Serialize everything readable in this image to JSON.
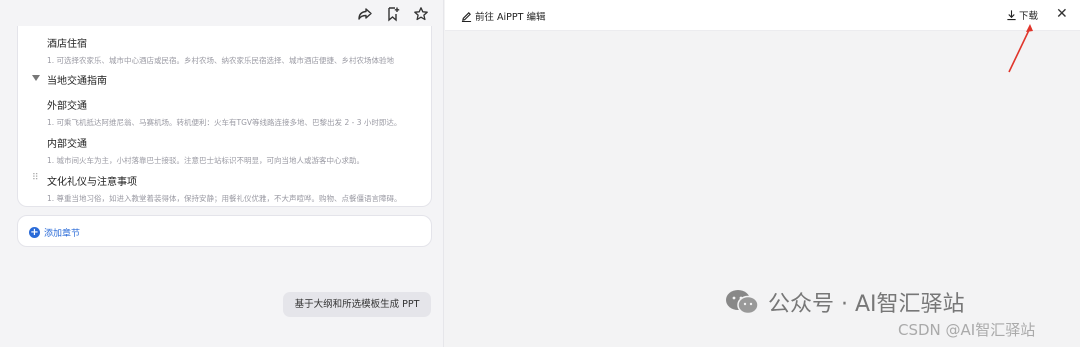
{
  "left_panel": {
    "toolbar_icons": [
      "share-icon",
      "bookmark-add-icon",
      "star-icon"
    ],
    "outline": {
      "items": [
        {
          "title": "酒店住宿",
          "desc": "1. 可选择农家乐、城市中心酒店或民宿。乡村农场、纳农家乐民宿选择、城市酒店便捷、乡村农场体验地"
        },
        {
          "section": "当地交通指南"
        },
        {
          "title": "外部交通",
          "desc": "1. 可乘飞机抵达阿维尼翁、马赛机场。转机便利：火车有TGV等线路连接多地、巴黎出发 2 - 3 小时即达。"
        },
        {
          "title": "内部交通",
          "desc": "1. 城市间火车为主，小村落靠巴士接驳。注意巴士站标识不明显，可向当地人或游客中心求助。"
        },
        {
          "title": "文化礼仪与注意事项",
          "desc": "1. 尊重当地习俗，如进入教堂着装得体，保持安静；用餐礼仪优雅，不大声喧哗。购物、点餐僵语言障碍。"
        }
      ]
    },
    "add_section_label": "添加章节",
    "generate_button_label": "基于大纲和所选模板生成 PPT"
  },
  "right_panel": {
    "goto_edit_label": "前往 AiPPT 编辑",
    "download_label": "下载"
  },
  "watermark": {
    "main": "公众号 · AI智汇驿站",
    "csdn": "CSDN @AI智汇驿站"
  },
  "colors": {
    "accent": "#2a6bd8",
    "arrow": "#e0352b"
  }
}
